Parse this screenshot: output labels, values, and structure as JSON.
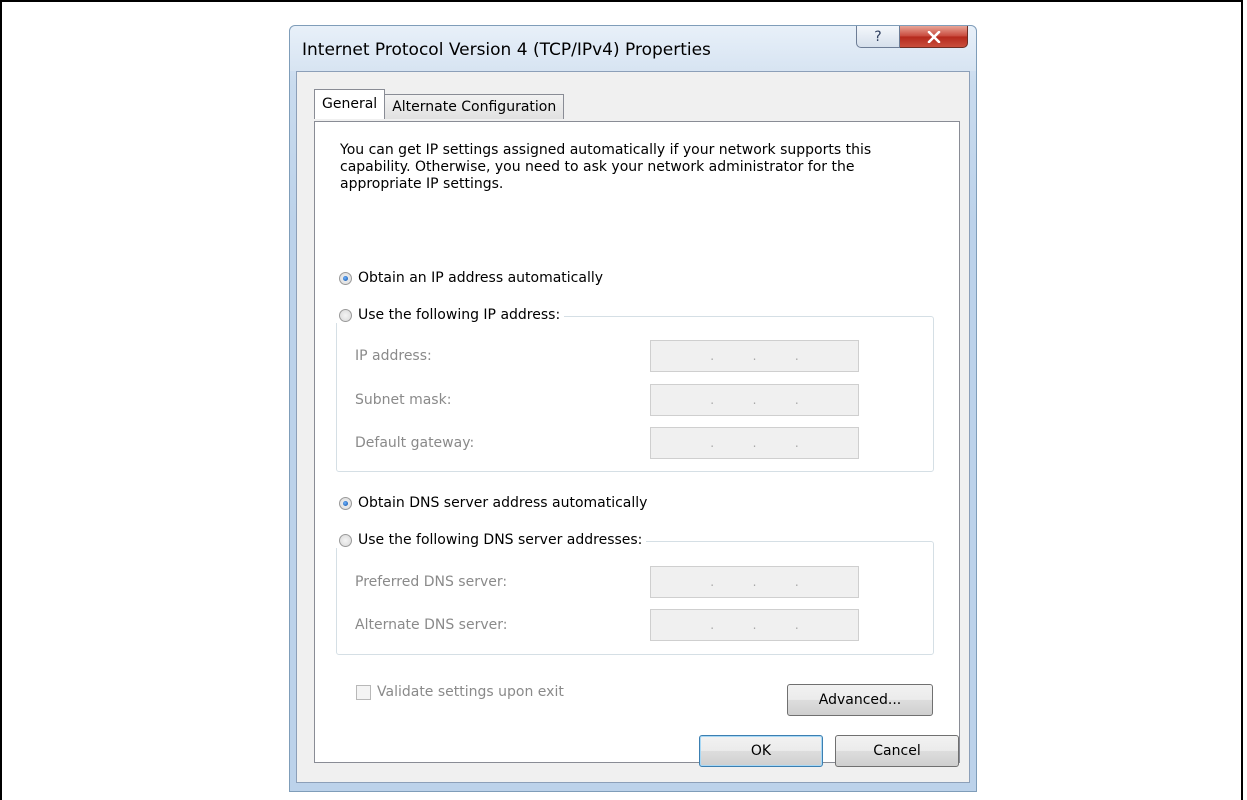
{
  "window": {
    "title": "Internet Protocol Version 4 (TCP/IPv4) Properties",
    "help_glyph": "?",
    "close_glyph": "X"
  },
  "tabs": [
    {
      "label": "General",
      "active": true
    },
    {
      "label": "Alternate Configuration",
      "active": false
    }
  ],
  "general": {
    "description": "You can get IP settings assigned automatically if your network supports this capability. Otherwise, you need to ask your network administrator for the appropriate IP settings.",
    "ip_auto_label": "Obtain an IP address automatically",
    "ip_manual_label": "Use the following IP address:",
    "ip_auto_selected": true,
    "ip_fields": [
      {
        "label": "IP address:",
        "value": ". . ."
      },
      {
        "label": "Subnet mask:",
        "value": ". . ."
      },
      {
        "label": "Default gateway:",
        "value": ". . ."
      }
    ],
    "dns_auto_label": "Obtain DNS server address automatically",
    "dns_manual_label": "Use the following DNS server addresses:",
    "dns_auto_selected": true,
    "dns_fields": [
      {
        "label": "Preferred DNS server:",
        "value": ". . ."
      },
      {
        "label": "Alternate DNS server:",
        "value": ". . ."
      }
    ],
    "validate_label": "Validate settings upon exit",
    "advanced_label": "Advanced..."
  },
  "buttons": {
    "ok": "OK",
    "cancel": "Cancel"
  },
  "colors": {
    "accent": "#3c7fb1",
    "close_red": "#c7473a",
    "disabled_text": "#8a8a8a"
  }
}
